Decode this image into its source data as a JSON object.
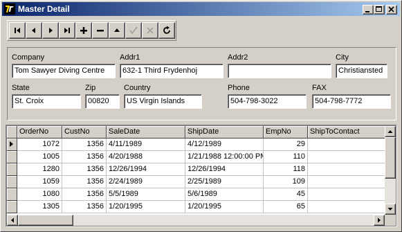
{
  "window": {
    "title": "Master Detail"
  },
  "icons": {
    "app": "delphi-app-icon",
    "minimize": "minimize-icon",
    "maximize": "maximize-icon",
    "close": "close-icon"
  },
  "navigator": {
    "buttons": [
      {
        "icon": "first-record-icon",
        "enabled": true
      },
      {
        "icon": "prior-record-icon",
        "enabled": true
      },
      {
        "icon": "next-record-icon",
        "enabled": true
      },
      {
        "icon": "last-record-icon",
        "enabled": true
      },
      {
        "icon": "insert-record-icon",
        "enabled": true
      },
      {
        "icon": "delete-record-icon",
        "enabled": true
      },
      {
        "icon": "edit-record-icon",
        "enabled": true
      },
      {
        "icon": "post-edit-icon",
        "enabled": false
      },
      {
        "icon": "cancel-edit-icon",
        "enabled": false
      },
      {
        "icon": "refresh-data-icon",
        "enabled": true
      }
    ]
  },
  "form": {
    "company_label": "Company",
    "company_value": "Tom Sawyer Diving Centre",
    "addr1_label": "Addr1",
    "addr1_value": "632-1 Third Frydenhoj",
    "addr2_label": "Addr2",
    "addr2_value": "",
    "city_label": "City",
    "city_value": "Christiansted",
    "state_label": "State",
    "state_value": "St. Croix",
    "zip_label": "Zip",
    "zip_value": "00820",
    "country_label": "Country",
    "country_value": "US Virgin Islands",
    "phone_label": "Phone",
    "phone_value": "504-798-3022",
    "fax_label": "FAX",
    "fax_value": "504-798-7772"
  },
  "grid": {
    "columns": [
      "OrderNo",
      "CustNo",
      "SaleDate",
      "ShipDate",
      "EmpNo",
      "ShipToContact"
    ],
    "rows": [
      [
        "1072",
        "1356",
        "4/11/1989",
        "4/12/1989",
        "29",
        ""
      ],
      [
        "1005",
        "1356",
        "4/20/1988",
        "1/21/1988 12:00:00 PM",
        "110",
        ""
      ],
      [
        "1280",
        "1356",
        "12/26/1994",
        "12/26/1994",
        "118",
        ""
      ],
      [
        "1059",
        "1356",
        "2/24/1989",
        "2/25/1989",
        "109",
        ""
      ],
      [
        "1080",
        "1356",
        "5/5/1989",
        "5/6/1989",
        "45",
        ""
      ],
      [
        "1305",
        "1356",
        "1/20/1995",
        "1/20/1995",
        "65",
        ""
      ]
    ],
    "current_row": 0
  }
}
